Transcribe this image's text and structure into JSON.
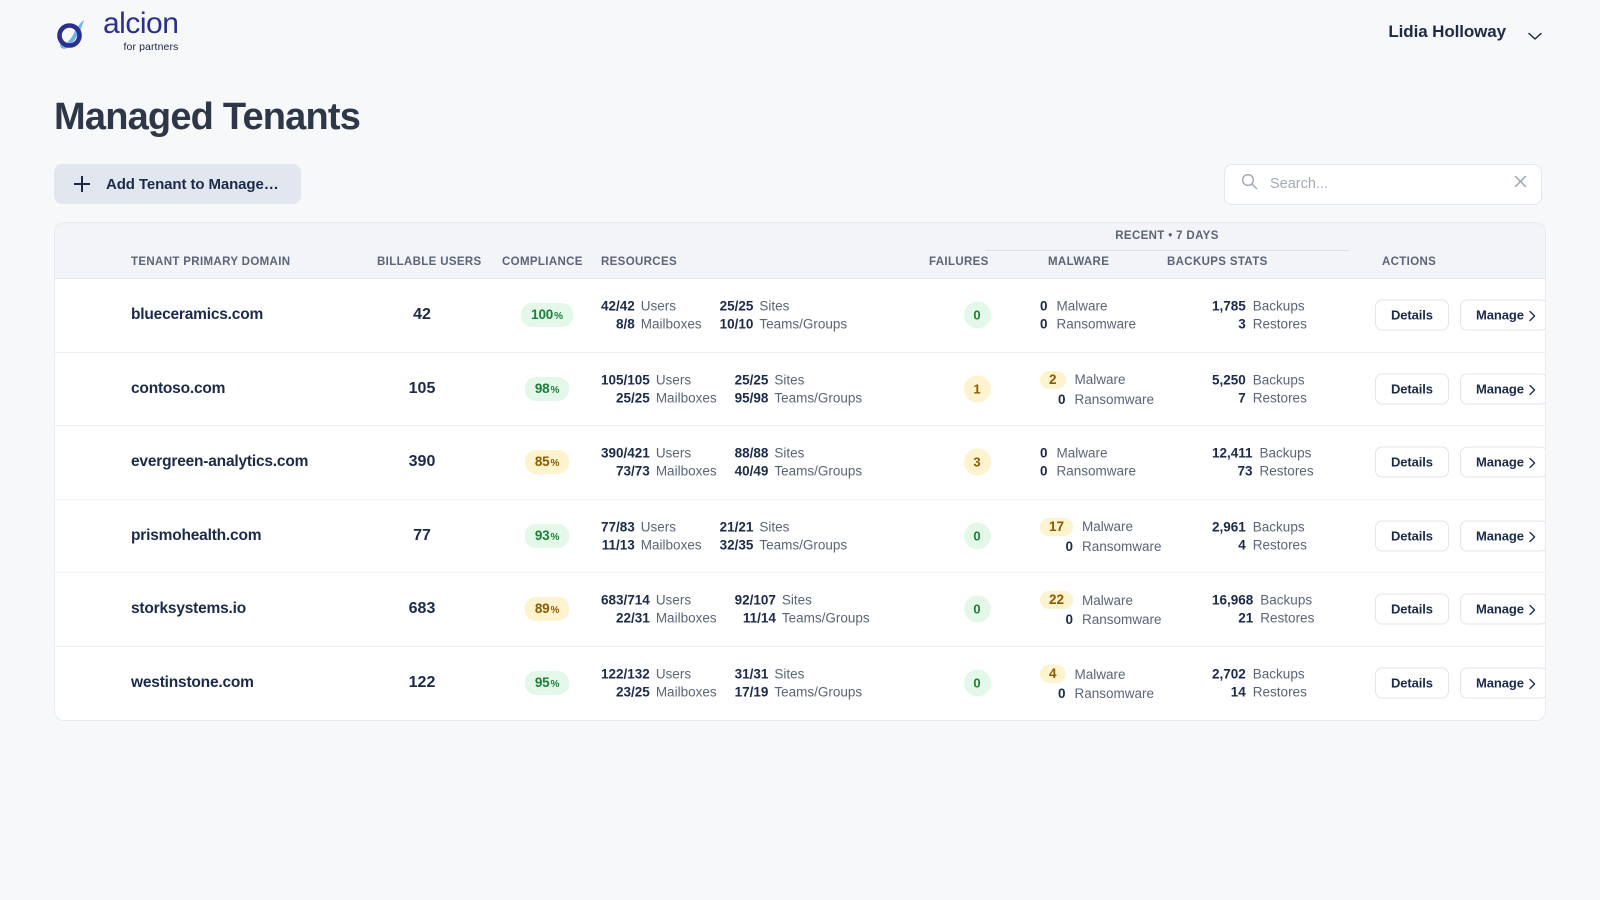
{
  "header": {
    "brand_word": "alcion",
    "brand_sub": "for partners",
    "user_name": "Lidia Holloway",
    "chevron_icon": "chevron-down-icon",
    "logo_icon": "alcion-logo-icon"
  },
  "page_title": "Managed Tenants",
  "toolbar": {
    "add_tenant_label": "Add Tenant to Manage…",
    "plus_icon": "plus-icon",
    "search_placeholder": "Search...",
    "search_value": "",
    "search_icon": "search-icon",
    "clear_icon": "close-icon"
  },
  "table": {
    "group_header": "RECENT • 7 DAYS",
    "columns": {
      "domain": "TENANT PRIMARY DOMAIN",
      "billable": "BILLABLE USERS",
      "compliance": "COMPLIANCE",
      "resources": "RESOURCES",
      "failures": "FAILURES",
      "malware": "MALWARE",
      "backups": "BACKUPS STATS",
      "actions": "ACTIONS"
    },
    "labels": {
      "users": "Users",
      "mailboxes": "Mailboxes",
      "sites": "Sites",
      "teams": "Teams/Groups",
      "malware": "Malware",
      "ransomware": "Ransomware",
      "backups": "Backups",
      "restores": "Restores",
      "details": "Details",
      "manage": "Manage",
      "percent_sign": "%"
    },
    "rows": [
      {
        "domain": "blueceramics.com",
        "billable": "42",
        "compliance": "100",
        "compliance_state": "good",
        "users": "42/42",
        "mailboxes": "8/8",
        "sites": "25/25",
        "teams": "10/10",
        "failures": "0",
        "failures_state": "good",
        "malware": "0",
        "malware_flagged": false,
        "ransomware": "0",
        "ransomware_flagged": false,
        "backups": "1,785",
        "restores": "3"
      },
      {
        "domain": "contoso.com",
        "billable": "105",
        "compliance": "98",
        "compliance_state": "good",
        "users": "105/105",
        "mailboxes": "25/25",
        "sites": "25/25",
        "teams": "95/98",
        "failures": "1",
        "failures_state": "warn",
        "malware": "2",
        "malware_flagged": true,
        "ransomware": "0",
        "ransomware_flagged": false,
        "backups": "5,250",
        "restores": "7"
      },
      {
        "domain": "evergreen-analytics.com",
        "billable": "390",
        "compliance": "85",
        "compliance_state": "warn",
        "users": "390/421",
        "mailboxes": "73/73",
        "sites": "88/88",
        "teams": "40/49",
        "failures": "3",
        "failures_state": "warn",
        "malware": "0",
        "malware_flagged": false,
        "ransomware": "0",
        "ransomware_flagged": false,
        "backups": "12,411",
        "restores": "73"
      },
      {
        "domain": "prismohealth.com",
        "billable": "77",
        "compliance": "93",
        "compliance_state": "good",
        "users": "77/83",
        "mailboxes": "11/13",
        "sites": "21/21",
        "teams": "32/35",
        "failures": "0",
        "failures_state": "good",
        "malware": "17",
        "malware_flagged": true,
        "ransomware": "0",
        "ransomware_flagged": false,
        "backups": "2,961",
        "restores": "4"
      },
      {
        "domain": "storksystems.io",
        "billable": "683",
        "compliance": "89",
        "compliance_state": "warn",
        "users": "683/714",
        "mailboxes": "22/31",
        "sites": "92/107",
        "teams": "11/14",
        "failures": "0",
        "failures_state": "good",
        "malware": "22",
        "malware_flagged": true,
        "ransomware": "0",
        "ransomware_flagged": false,
        "backups": "16,968",
        "restores": "21"
      },
      {
        "domain": "westinstone.com",
        "billable": "122",
        "compliance": "95",
        "compliance_state": "good",
        "users": "122/132",
        "mailboxes": "23/25",
        "sites": "31/31",
        "teams": "17/19",
        "failures": "0",
        "failures_state": "good",
        "malware": "4",
        "malware_flagged": true,
        "ransomware": "0",
        "ransomware_flagged": false,
        "backups": "2,702",
        "restores": "14"
      }
    ]
  },
  "colors": {
    "page_bg": "#f7f8fa",
    "brand_blue": "#2b2f8f",
    "brand_light_blue": "#6bb6e8",
    "title": "#2d3748",
    "good": "#1a7f37",
    "good_bg": "#e3f8e9",
    "warn": "#8a5a00",
    "warn_bg": "#fdf3ce"
  }
}
